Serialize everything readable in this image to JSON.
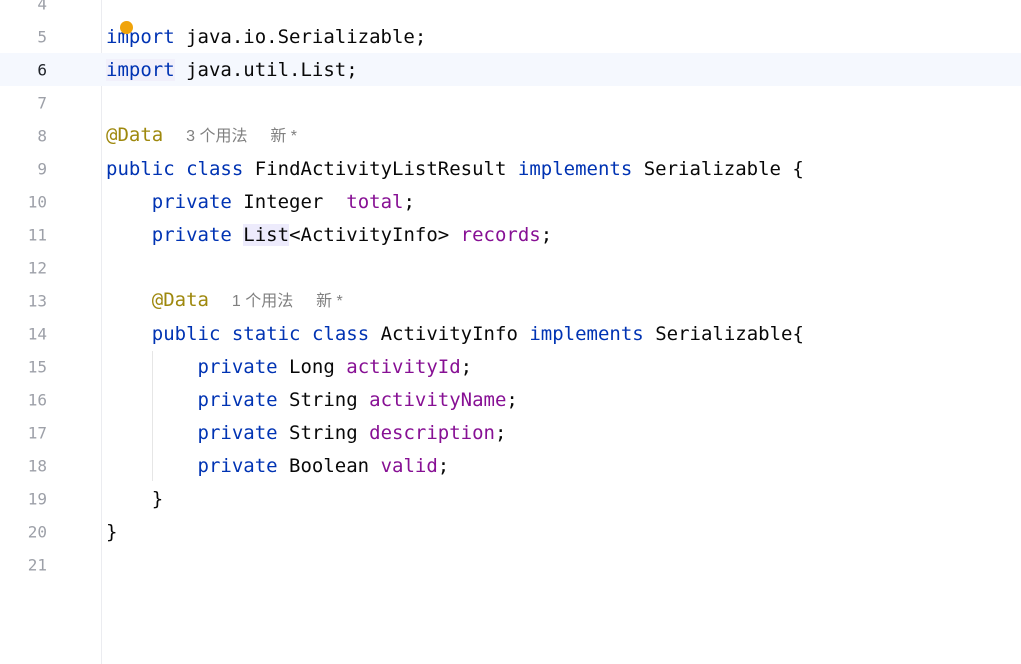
{
  "editor": {
    "lines": {
      "l4": {
        "num": "4"
      },
      "l5": {
        "num": "5",
        "kw": "import",
        "rest": " java.io.Serializable;"
      },
      "l6": {
        "num": "6",
        "kw": "import",
        "rest": " java.util.List;"
      },
      "l7": {
        "num": "7"
      },
      "l8": {
        "num": "8",
        "annotation": "@Data",
        "usages": "3 个用法",
        "author": "新 *"
      },
      "l9": {
        "num": "9",
        "kw1": "public",
        "kw2": "class",
        "name": "FindActivityListResult",
        "kw3": "implements",
        "iface": "Serializable {"
      },
      "l10": {
        "num": "10",
        "kw": "private",
        "type": "Integer",
        "field": "total",
        "end": ";"
      },
      "l11": {
        "num": "11",
        "kw": "private",
        "type": "List",
        "generic": "<ActivityInfo>",
        "field": "records",
        "end": ";"
      },
      "l12": {
        "num": "12"
      },
      "l13": {
        "num": "13",
        "annotation": "@Data",
        "usages": "1 个用法",
        "author": "新 *"
      },
      "l14": {
        "num": "14",
        "kw1": "public",
        "kw2": "static",
        "kw3": "class",
        "name": "ActivityInfo",
        "kw4": "implements",
        "iface": "Serializable{"
      },
      "l15": {
        "num": "15",
        "kw": "private",
        "type": "Long",
        "field": "activityId",
        "end": ";"
      },
      "l16": {
        "num": "16",
        "kw": "private",
        "type": "String",
        "field": "activityName",
        "end": ";"
      },
      "l17": {
        "num": "17",
        "kw": "private",
        "type": "String",
        "field": "description",
        "end": ";"
      },
      "l18": {
        "num": "18",
        "kw": "private",
        "type": "Boolean",
        "field": "valid",
        "end": ";"
      },
      "l19": {
        "num": "19",
        "text": "}"
      },
      "l20": {
        "num": "20",
        "text": "}"
      },
      "l21": {
        "num": "21"
      }
    },
    "colors": {
      "keyword": "#0033b3",
      "field": "#871094",
      "annotation": "#9e880d",
      "hint": "#808080",
      "bulb": "#f0a30a"
    },
    "icons": [
      "intention-bulb-icon"
    ]
  }
}
